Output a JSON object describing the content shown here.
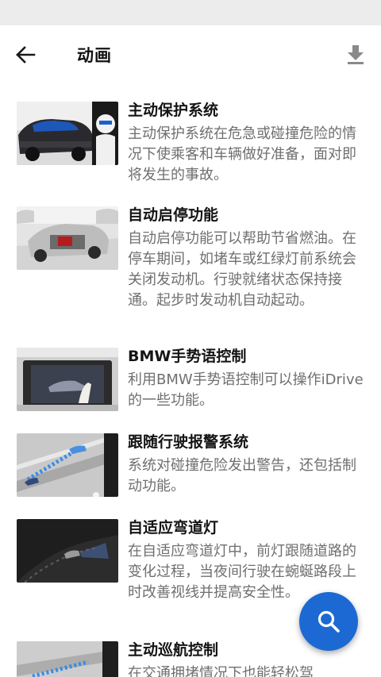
{
  "header": {
    "title": "动画",
    "back_icon": "arrow-back-icon",
    "download_icon": "download-icon"
  },
  "items": [
    {
      "title": "主动保护系统",
      "description": "主动保护系统在危急或碰撞危险的情况下使乘客和车辆做好准备，面对即将发生的事故。"
    },
    {
      "title": "自动启停功能",
      "description": "自动启停功能可以帮助节省燃油。在停车期间，如堵车或红绿灯前系统会关闭发动机。行驶就绪状态保持接通。起步时发动机自动起动。"
    },
    {
      "title": "BMW手势语控制",
      "description": "利用BMW手势语控制可以操作iDrive的一些功能。"
    },
    {
      "title": "跟随行驶报警系统",
      "description": "系统对碰撞危险发出警告，还包括制动功能。"
    },
    {
      "title": "自适应弯道灯",
      "description": "在自适应弯道灯中，前灯跟随道路的变化过程，当夜间行驶在蜿蜒路段上时改善视线并提高安全性。"
    },
    {
      "title": "主动巡航控制",
      "description": "在交通拥堵情况下也能轻松驾"
    }
  ],
  "fab": {
    "icon": "search-icon"
  },
  "colors": {
    "accent": "#1c69d3",
    "title_text": "#141414",
    "desc_text": "#6f6f6f"
  }
}
